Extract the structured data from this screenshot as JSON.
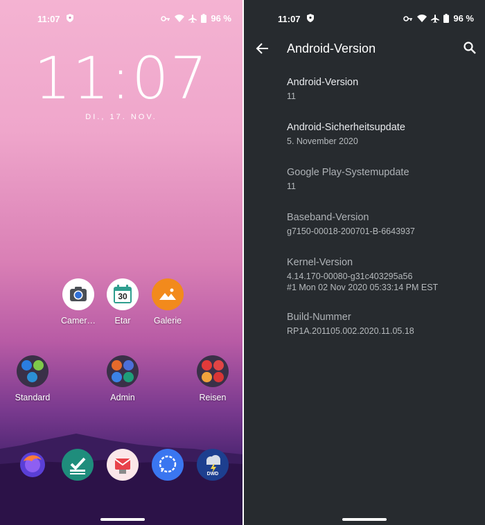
{
  "home": {
    "status": {
      "time": "11:07",
      "battery": "96 %"
    },
    "clock": "11:07",
    "date": "DI., 17. NOV.",
    "apps": [
      {
        "label": "Camer…"
      },
      {
        "label": "Etar",
        "day": "30"
      },
      {
        "label": "Galerie"
      }
    ],
    "folders": [
      {
        "label": "Standard"
      },
      {
        "label": "Admin"
      },
      {
        "label": "Reisen"
      }
    ],
    "dock": {
      "dwd_text": "DWD"
    }
  },
  "settings": {
    "status": {
      "time": "11:07",
      "battery": "96 %"
    },
    "title": "Android-Version",
    "items": [
      {
        "title": "Android-Version",
        "summary": "11"
      },
      {
        "title": "Android-Sicherheitsupdate",
        "summary": "5. November 2020"
      },
      {
        "title": "Google Play-Systemupdate",
        "summary": "11"
      },
      {
        "title": "Baseband-Version",
        "summary": "g7150-00018-200701-B-6643937"
      },
      {
        "title": "Kernel-Version",
        "summary": "4.14.170-00080-g31c403295a56",
        "summary2": "#1 Mon 02 Nov 2020 05:33:14 PM EST"
      },
      {
        "title": "Build-Nummer",
        "summary": "RP1A.201105.002.2020.11.05.18"
      }
    ]
  },
  "colors": {
    "settings_bg": "#272b2f",
    "wallpaper_top": "#f4b3d2",
    "wallpaper_bottom": "#2e164f"
  }
}
